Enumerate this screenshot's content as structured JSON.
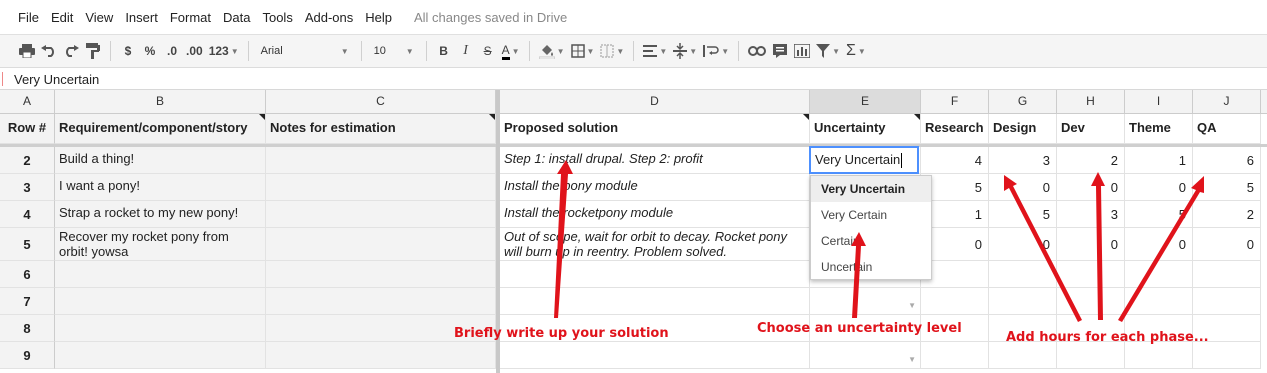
{
  "menu": {
    "items": [
      "File",
      "Edit",
      "View",
      "Insert",
      "Format",
      "Data",
      "Tools",
      "Add-ons",
      "Help"
    ],
    "save_status": "All changes saved in Drive"
  },
  "toolbar": {
    "currency": "$",
    "percent": "%",
    "decrease_decimal": ".0",
    "increase_decimal": ".00",
    "more_formats": "123",
    "font": "Arial",
    "font_size": "10",
    "bold": "B",
    "italic": "I",
    "strike": "S",
    "text_color": "A",
    "sum": "Σ"
  },
  "formula_bar": {
    "value": "Very Uncertain"
  },
  "columns": [
    "A",
    "B",
    "C",
    "D",
    "E",
    "F",
    "G",
    "H",
    "I",
    "J"
  ],
  "header_row": {
    "a": "Row #",
    "b": "Requirement/component/story",
    "c": "Notes for estimation",
    "d": "Proposed solution",
    "e": "Uncertainty",
    "f": "Research",
    "g": "Design",
    "h": "Dev",
    "i": "Theme",
    "j": "QA"
  },
  "rows": [
    {
      "num": "2",
      "b": "Build a thing!",
      "d": "Step 1: install drupal.  Step 2: profit",
      "e": "Very Uncertain",
      "f": "4",
      "g": "3",
      "h": "2",
      "i": "1",
      "j": "6"
    },
    {
      "num": "3",
      "b": "I want a pony!",
      "d": "Install the pony module",
      "e": "",
      "f": "5",
      "g": "0",
      "h": "0",
      "i": "0",
      "j": "5"
    },
    {
      "num": "4",
      "b": "Strap a rocket to my new pony!",
      "d": "Install the rocketpony module",
      "e": "",
      "f": "1",
      "g": "5",
      "h": "3",
      "i": "5",
      "j": "2"
    },
    {
      "num": "5",
      "b": "Recover my rocket pony from orbit! yowsa",
      "d": "Out of scope, wait for orbit to decay.  Rocket pony will burn up in reentry.  Problem solved.",
      "e": "",
      "f": "0",
      "g": "0",
      "h": "0",
      "i": "0",
      "j": "0"
    },
    {
      "num": "6"
    },
    {
      "num": "7"
    },
    {
      "num": "8"
    },
    {
      "num": "9"
    }
  ],
  "dropdown": {
    "options": [
      "Very Uncertain",
      "Very Certain",
      "Certain",
      "Uncertain"
    ]
  },
  "annotations": {
    "solution": "Briefly write up your solution",
    "uncertainty": "Choose an uncertainty level",
    "hours": "Add hours for each phase..."
  },
  "colors": {
    "annotation": "#e0131b",
    "active_border": "#4d90fe"
  }
}
